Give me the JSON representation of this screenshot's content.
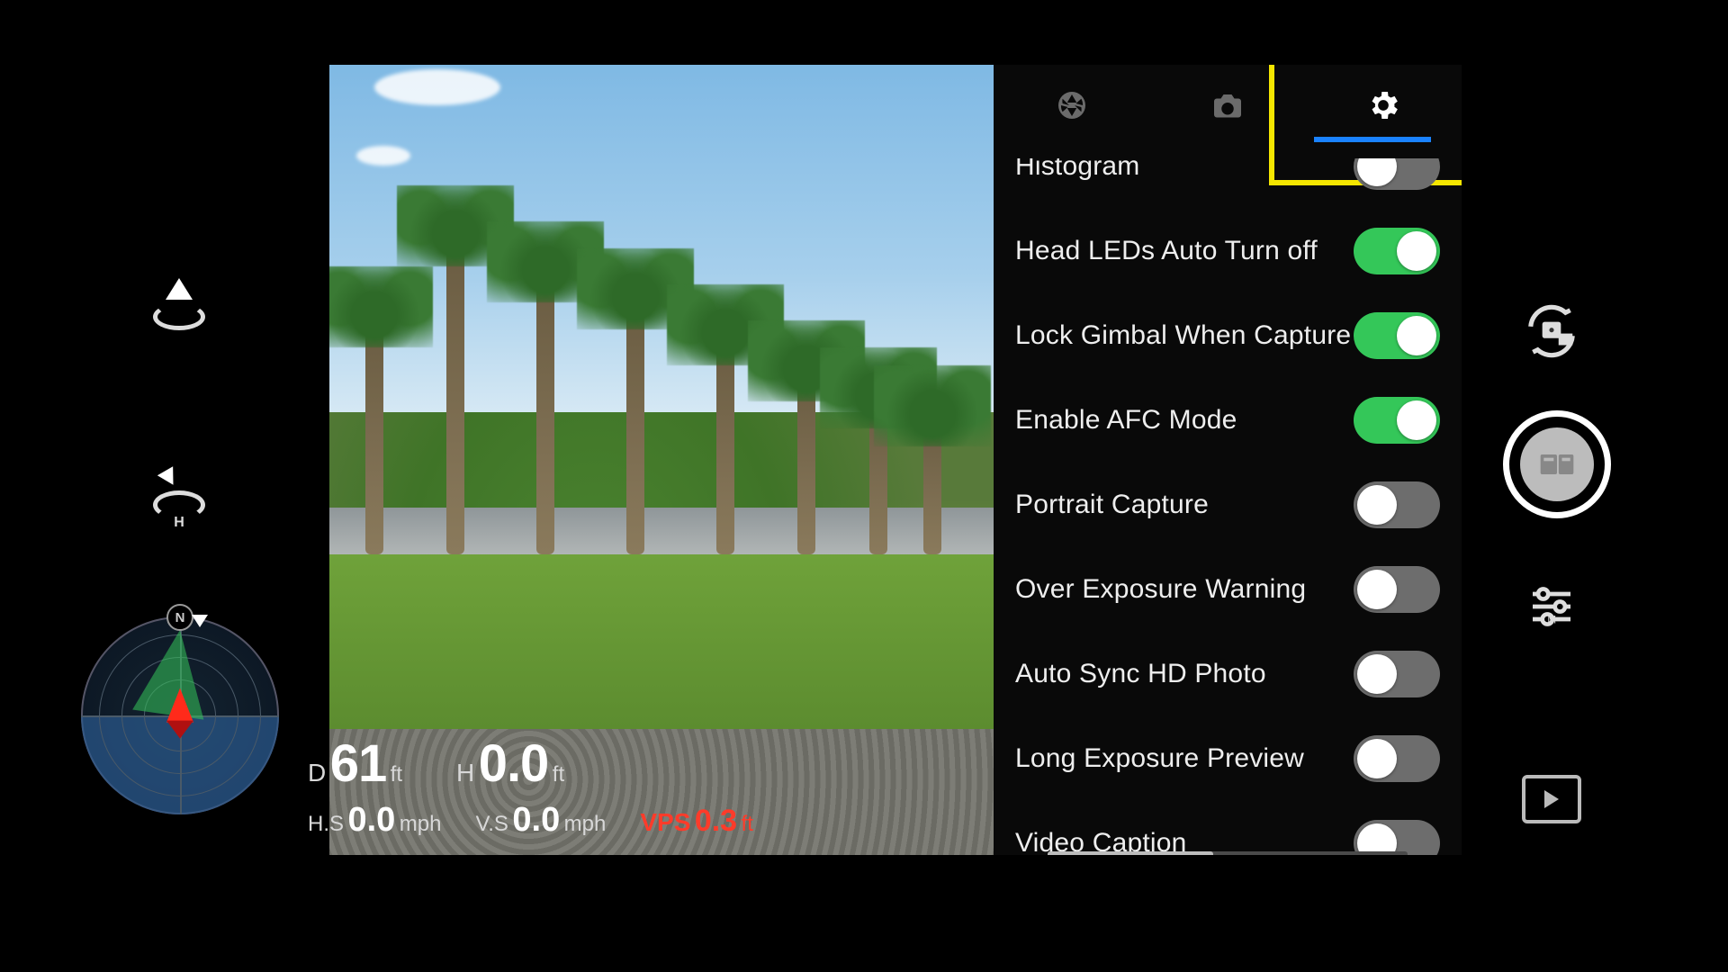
{
  "compass": {
    "n_label": "N"
  },
  "telemetry": {
    "dist_label": "D",
    "dist_value": "61",
    "dist_unit": "ft",
    "height_label": "H",
    "height_value": "0.0",
    "height_unit": "ft",
    "hs_label": "H.S",
    "hs_value": "0.0",
    "hs_unit": "mph",
    "vs_label": "V.S",
    "vs_value": "0.0",
    "vs_unit": "mph",
    "vps_label": "VPS",
    "vps_value": "0.3",
    "vps_unit": "ft"
  },
  "settings_tabs": {
    "active_index": 2
  },
  "settings": [
    {
      "label": "Histogram",
      "enabled": false
    },
    {
      "label": "Head LEDs Auto Turn off",
      "enabled": true
    },
    {
      "label": "Lock Gimbal When Capture",
      "enabled": true
    },
    {
      "label": "Enable AFC Mode",
      "enabled": true
    },
    {
      "label": "Portrait Capture",
      "enabled": false
    },
    {
      "label": "Over Exposure Warning",
      "enabled": false
    },
    {
      "label": "Auto Sync HD Photo",
      "enabled": false
    },
    {
      "label": "Long Exposure Preview",
      "enabled": false
    },
    {
      "label": "Video Caption",
      "enabled": false
    }
  ]
}
